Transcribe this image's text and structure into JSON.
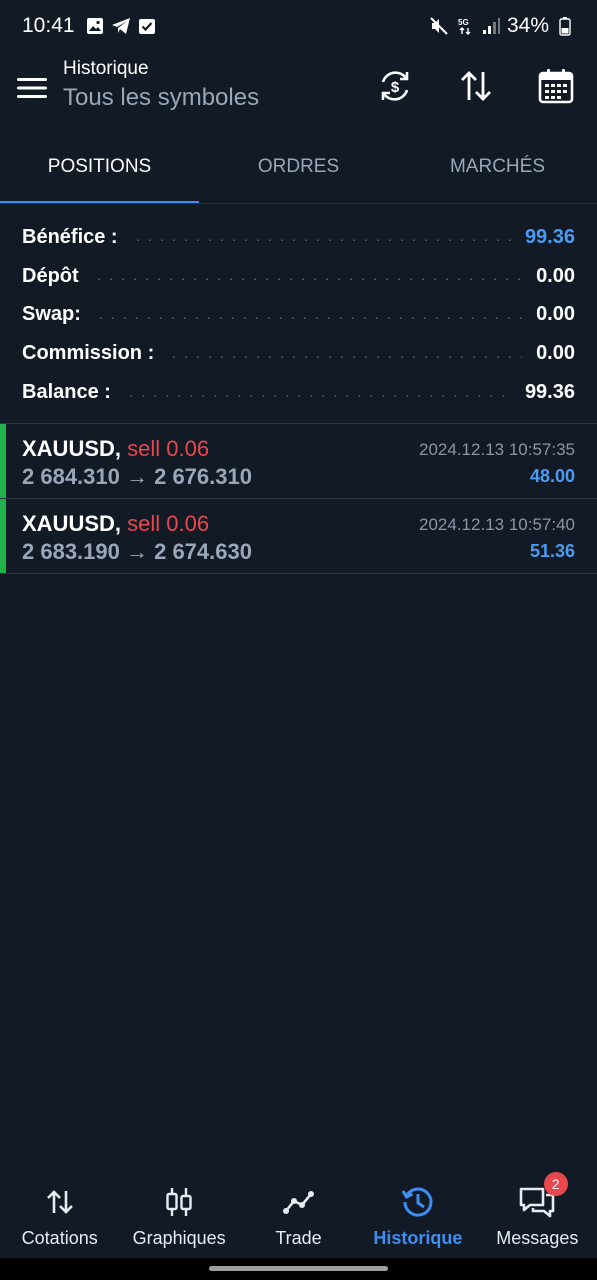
{
  "status_bar": {
    "time": "10:41",
    "battery": "34%",
    "icons": [
      "image-icon",
      "telegram-icon",
      "check-square-icon",
      "mute-vibrate-icon",
      "5g-icon",
      "signal-icon",
      "battery-icon"
    ]
  },
  "header": {
    "subtitle": "Historique",
    "title": "Tous les symboles",
    "icons": [
      "menu-icon",
      "currency-refresh-icon",
      "sort-icon",
      "calendar-icon"
    ]
  },
  "tabs": [
    {
      "label": "POSITIONS",
      "active": true
    },
    {
      "label": "ORDRES",
      "active": false
    },
    {
      "label": "MARCHÉS",
      "active": false
    }
  ],
  "summary": [
    {
      "label": "Bénéfice :",
      "value": "99.36",
      "highlight": true
    },
    {
      "label": "Dépôt",
      "value": "0.00",
      "highlight": false
    },
    {
      "label": "Swap:",
      "value": "0.00",
      "highlight": false
    },
    {
      "label": "Commission :",
      "value": "0.00",
      "highlight": false
    },
    {
      "label": "Balance :",
      "value": "99.36",
      "highlight": false
    }
  ],
  "deals": [
    {
      "symbol": "XAUUSD,",
      "side": "sell 0.06",
      "prices": "2 684.310 → 2 676.310",
      "date": "2024.12.13 10:57:35",
      "profit": "48.00"
    },
    {
      "symbol": "XAUUSD,",
      "side": "sell 0.06",
      "prices": "2 683.190 → 2 674.630",
      "date": "2024.12.13 10:57:40",
      "profit": "51.36"
    }
  ],
  "bottom_nav": [
    {
      "label": "Cotations",
      "icon": "arrows-updown-icon",
      "active": false
    },
    {
      "label": "Graphiques",
      "icon": "candlestick-icon",
      "active": false
    },
    {
      "label": "Trade",
      "icon": "trade-line-icon",
      "active": false
    },
    {
      "label": "Historique",
      "icon": "history-icon",
      "active": true
    },
    {
      "label": "Messages",
      "icon": "messages-icon",
      "active": false,
      "badge": "2"
    }
  ],
  "colors": {
    "background": "#121a25",
    "accent": "#3d8ef0",
    "profit": "#4c9bf2",
    "sell": "#e8484d",
    "buy_bar": "#22b24c"
  }
}
